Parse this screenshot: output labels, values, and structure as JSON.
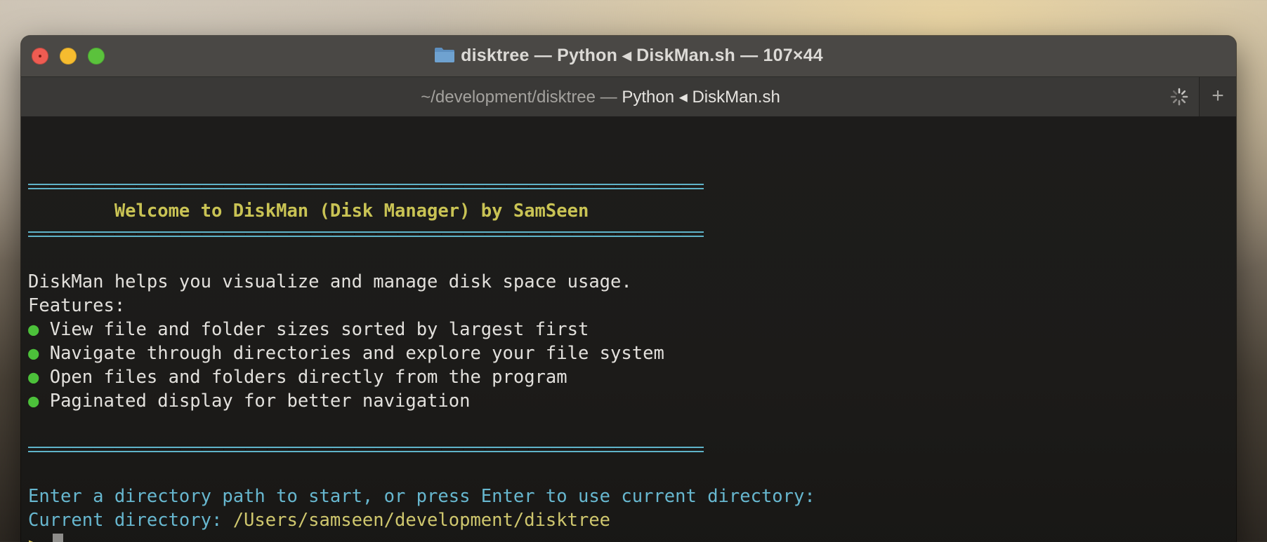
{
  "window": {
    "title": "disktree — Python ◂ DiskMan.sh — 107×44",
    "folder_icon": "folder-icon"
  },
  "tab": {
    "path": "~/development/disktree",
    "separator": " — ",
    "process": "Python ◂ DiskMan.sh",
    "spinner_icon": "spinner-icon",
    "new_tab_label": "+"
  },
  "terminal": {
    "welcome": "        Welcome to DiskMan (Disk Manager) by SamSeen",
    "intro": "DiskMan helps you visualize and manage disk space usage.",
    "features_label": "Features:",
    "bullet_glyph": "●",
    "features": [
      "View file and folder sizes sorted by largest first",
      "Navigate through directories and explore your file system",
      "Open files and folders directly from the program",
      "Paginated display for better navigation"
    ],
    "enter_prompt": "Enter a directory path to start, or press Enter to use current directory:",
    "current_dir_label": "Current directory: ",
    "current_dir_value": "/Users/samseen/development/disktree",
    "prompt_symbol": ">"
  },
  "colors": {
    "rule": "#5fb3c9",
    "welcome": "#c9c354",
    "bullet": "#4cc13a",
    "cyan_text": "#67b7cf",
    "path_yellow": "#cfc76e",
    "close": "#ee5c52",
    "minimize": "#f6bc2f",
    "zoom": "#5bc23c"
  }
}
